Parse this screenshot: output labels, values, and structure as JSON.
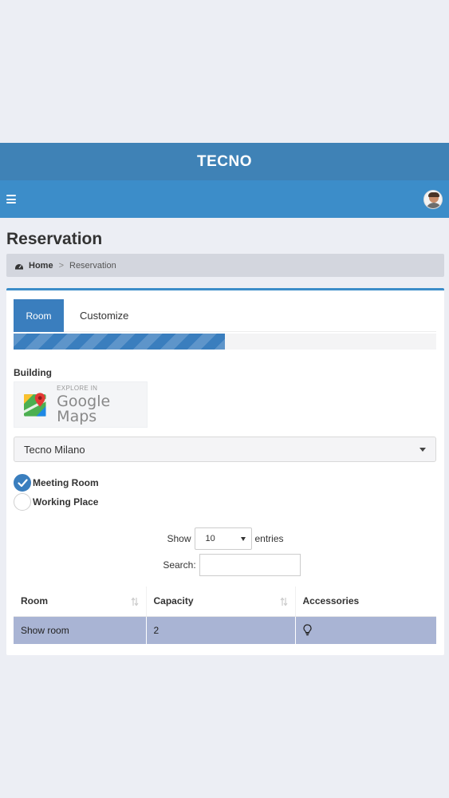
{
  "header": {
    "brand": "TECNO"
  },
  "page": {
    "title": "Reservation"
  },
  "breadcrumb": {
    "home": "Home",
    "separator": ">",
    "current": "Reservation"
  },
  "tabs": [
    {
      "label": "Room",
      "active": true
    },
    {
      "label": "Customize",
      "active": false
    }
  ],
  "progress": {
    "fraction": 0.5
  },
  "building": {
    "label": "Building",
    "maps": {
      "small": "EXPLORE IN",
      "big": "Google Maps"
    },
    "selected": "Tecno Milano"
  },
  "room_type": [
    {
      "label": "Meeting Room",
      "checked": true
    },
    {
      "label": "Working Place",
      "checked": false
    }
  ],
  "table_controls": {
    "show_label": "Show",
    "entries_value": "10",
    "entries_label": "entries",
    "search_label": "Search:",
    "search_value": ""
  },
  "table": {
    "columns": [
      "Room",
      "Capacity",
      "Accessories"
    ],
    "rows": [
      {
        "room": "Show room",
        "capacity": "2",
        "accessories_icon": "lightbulb-icon"
      }
    ]
  },
  "colors": {
    "brand_bar": "#3f82b6",
    "nav_bar": "#3c8dc9",
    "accent": "#3a7ebe",
    "row_highlight": "#a9b4d4"
  }
}
